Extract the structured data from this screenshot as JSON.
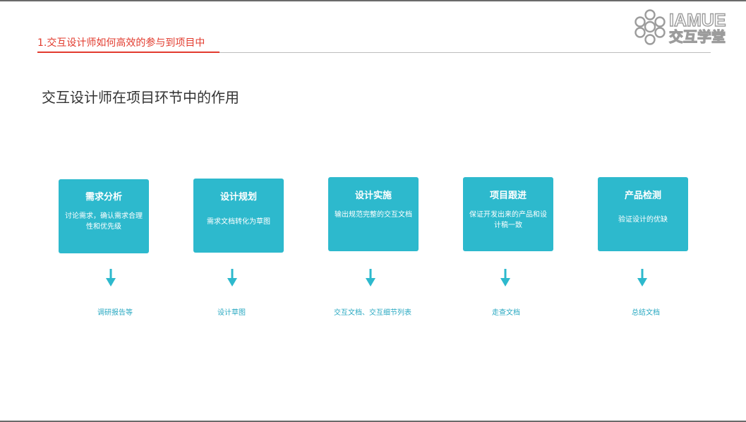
{
  "header": {
    "section_title": "1.交互设计师如何高效的参与到项目中",
    "logo_en": "IAMUE",
    "logo_cn": "交互学堂"
  },
  "main_heading": "交互设计师在项目环节中的作用",
  "steps": [
    {
      "title": "需求分析",
      "desc": "讨论需求，确认需求合理性和优先级",
      "output": "调研报告等"
    },
    {
      "title": "设计规划",
      "desc": "需求文档转化为草图",
      "output": "设计草图"
    },
    {
      "title": "设计实施",
      "desc": "输出规范完整的交互文档",
      "output": "交互文档、交互细节列表"
    },
    {
      "title": "项目跟进",
      "desc": "保证开发出来的产品和设计稿一致",
      "output": "走查文档"
    },
    {
      "title": "产品检测",
      "desc": "验证设计的优缺",
      "output": "总结文档"
    }
  ],
  "colors": {
    "accent_red": "#e23b2e",
    "step_teal": "#2db9cd",
    "output_teal": "#2aa9c2"
  },
  "icons": {
    "arrow": "arrow-down-icon",
    "logo": "iamue-logo-icon"
  }
}
